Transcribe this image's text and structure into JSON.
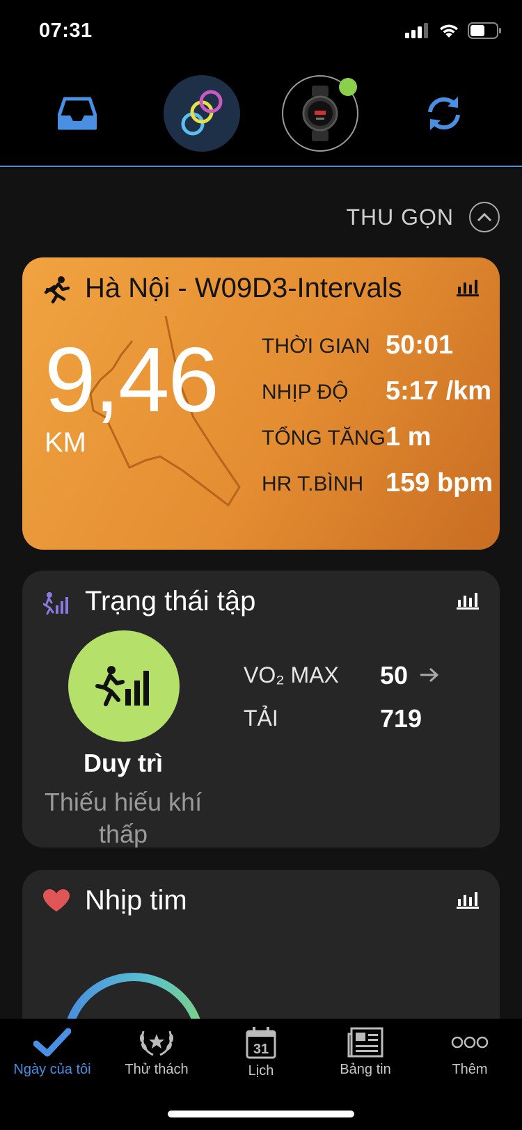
{
  "status_bar": {
    "time": "07:31",
    "icons": [
      "signal-icon",
      "wifi-icon",
      "battery-icon"
    ]
  },
  "top_bar": {
    "buttons": [
      "inbox-icon",
      "connect-iq-icon",
      "watch-icon",
      "sync-icon"
    ],
    "device_connected_color": "#8ad04a"
  },
  "collapse": {
    "label": "THU GỌN"
  },
  "activity_card": {
    "title": "Hà Nội - W09D3-Intervals",
    "distance": "9,46",
    "distance_unit": "KM",
    "stats": [
      {
        "label": "THỜI GIAN",
        "value": "50:01"
      },
      {
        "label": "NHỊP ĐỘ",
        "value": "5:17 /km"
      },
      {
        "label": "TỔNG TĂNG",
        "value": "1 m"
      },
      {
        "label": "HR T.BÌNH",
        "value": "159 bpm"
      }
    ]
  },
  "training_status_card": {
    "title": "Trạng thái tập",
    "status_name": "Duy trì",
    "status_desc": "Thiếu hiếu khí thấp",
    "metrics": [
      {
        "label": "VO₂ MAX",
        "value": "50"
      },
      {
        "label": "TẢI",
        "value": "719"
      }
    ],
    "status_color": "#b5e06a"
  },
  "heart_rate_card": {
    "title": "Nhịp tim",
    "heart_color": "#e05555"
  },
  "bottom_nav": {
    "items": [
      {
        "label": "Ngày của tôi",
        "icon": "checkmark-icon"
      },
      {
        "label": "Thử thách",
        "icon": "laurel-icon"
      },
      {
        "label": "Lịch",
        "icon": "calendar-icon",
        "calendar_day": "31"
      },
      {
        "label": "Bảng tin",
        "icon": "newsfeed-icon"
      },
      {
        "label": "Thêm",
        "icon": "more-icon"
      }
    ],
    "active_color": "#4a90e2"
  }
}
